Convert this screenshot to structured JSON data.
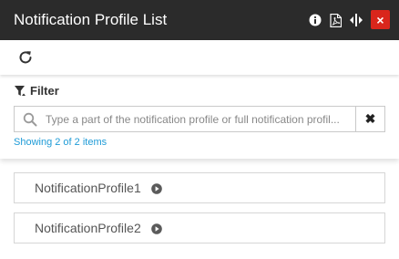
{
  "window": {
    "title": "Notification Profile List",
    "close_label": "×",
    "header_icons": [
      "info-icon",
      "pdf-icon",
      "resize-icon"
    ],
    "colors": {
      "titlebar_bg": "#2b2b2b",
      "close_bg": "#d9261c",
      "link": "#1e9bd7"
    }
  },
  "toolbar": {
    "refresh_icon": "refresh-icon"
  },
  "filter": {
    "label": "Filter",
    "search_placeholder": "Type a part of the notification profile or full notification profil...",
    "search_value": "",
    "clear_label": "✖",
    "showing_text": "Showing 2 of 2 items"
  },
  "profiles": [
    {
      "label": "NotificationProfile1",
      "icon": "play-circle-icon"
    },
    {
      "label": "NotificationProfile2",
      "icon": "play-circle-icon"
    }
  ]
}
